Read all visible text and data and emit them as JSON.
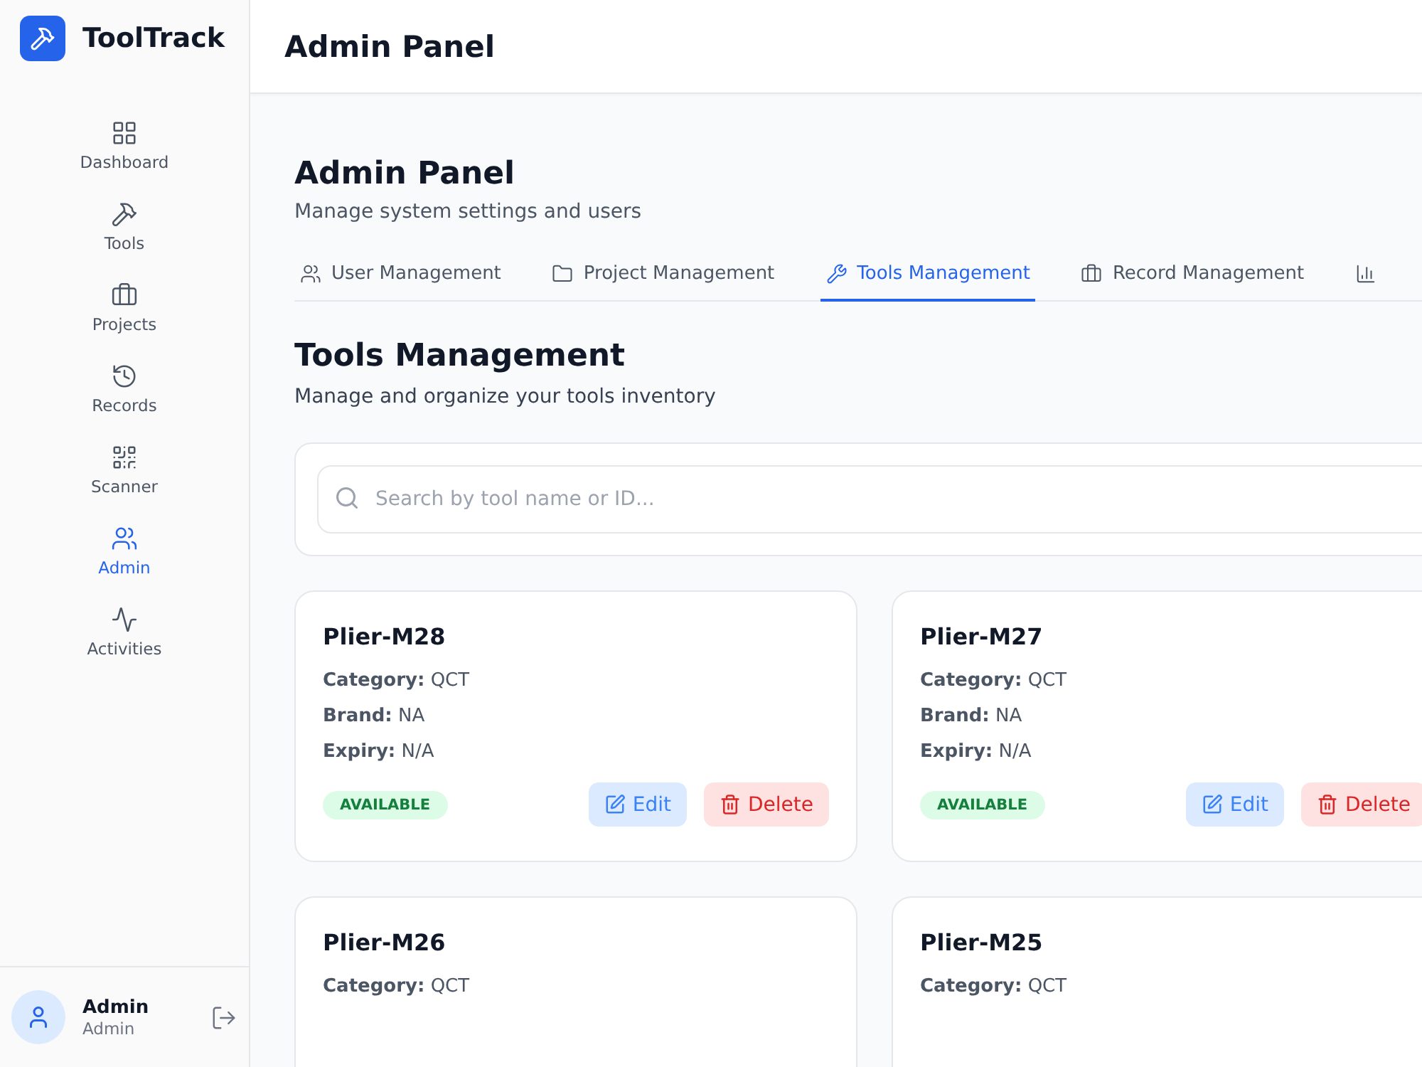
{
  "brand": {
    "name": "ToolTrack"
  },
  "sidebar": {
    "items": [
      {
        "kind": "dashboard",
        "label": "Dashboard",
        "selected": false
      },
      {
        "kind": "tools",
        "label": "Tools",
        "selected": false
      },
      {
        "kind": "projects",
        "label": "Projects",
        "selected": false
      },
      {
        "kind": "records",
        "label": "Records",
        "selected": false
      },
      {
        "kind": "scanner",
        "label": "Scanner",
        "selected": false
      },
      {
        "kind": "admin",
        "label": "Admin",
        "selected": true
      },
      {
        "kind": "activities",
        "label": "Activities",
        "selected": false
      }
    ]
  },
  "user": {
    "name": "Admin",
    "role": "Admin"
  },
  "header": {
    "title": "Admin Panel"
  },
  "page": {
    "title": "Admin Panel",
    "subtitle": "Manage system settings and users"
  },
  "tabs": [
    {
      "kind": "users",
      "label": "User Management",
      "selected": false
    },
    {
      "kind": "folder",
      "label": "Project Management",
      "selected": false
    },
    {
      "kind": "wrench",
      "label": "Tools Management",
      "selected": true
    },
    {
      "kind": "briefcase",
      "label": "Record Management",
      "selected": false
    },
    {
      "kind": "chart",
      "selected": false
    }
  ],
  "section": {
    "title": "Tools Management",
    "subtitle": "Manage and organize your tools inventory"
  },
  "search": {
    "placeholder": "Search by tool name or ID..."
  },
  "tools": [
    {
      "name": "Plier-M28",
      "fields": [
        {
          "label": "Category:",
          "value": "QCT"
        },
        {
          "label": "Brand:",
          "value": "NA"
        },
        {
          "label": "Expiry:",
          "value": "N/A"
        }
      ],
      "status": "AVAILABLE",
      "edit": "Edit",
      "delete": "Delete"
    },
    {
      "name": "Plier-M27",
      "fields": [
        {
          "label": "Category:",
          "value": "QCT"
        },
        {
          "label": "Brand:",
          "value": "NA"
        },
        {
          "label": "Expiry:",
          "value": "N/A"
        }
      ],
      "status": "AVAILABLE",
      "edit": "Edit",
      "delete": "Delete"
    },
    {
      "name": "Plier-M26",
      "fields": [
        {
          "label": "Category:",
          "value": "QCT"
        }
      ]
    },
    {
      "name": "Plier-M25",
      "fields": [
        {
          "label": "Category:",
          "value": "QCT"
        }
      ]
    }
  ]
}
